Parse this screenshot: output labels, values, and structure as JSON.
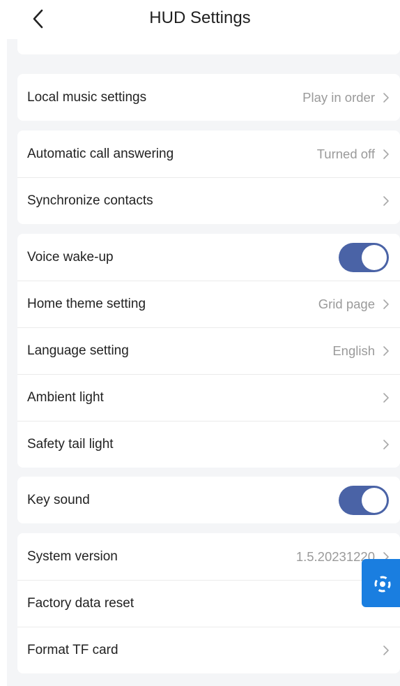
{
  "header": {
    "title": "HUD Settings",
    "back_icon": "chevron-left-icon"
  },
  "groups": {
    "music": {
      "rows": [
        {
          "label": "Local music settings",
          "value": "Play in order"
        }
      ]
    },
    "call": {
      "rows": [
        {
          "label": "Automatic call answering",
          "value": "Turned off"
        },
        {
          "label": "Synchronize contacts",
          "value": ""
        }
      ]
    },
    "general": {
      "rows": [
        {
          "label": "Voice wake-up",
          "toggle": true
        },
        {
          "label": "Home theme setting",
          "value": "Grid page"
        },
        {
          "label": "Language setting",
          "value": "English"
        },
        {
          "label": "Ambient light",
          "value": ""
        },
        {
          "label": "Safety tail light",
          "value": ""
        }
      ]
    },
    "sound": {
      "rows": [
        {
          "label": "Key sound",
          "toggle": true
        }
      ]
    },
    "system": {
      "rows": [
        {
          "label": "System version",
          "value": "1.5.20231220"
        },
        {
          "label": "Factory data reset",
          "value": ""
        },
        {
          "label": "Format TF card",
          "value": ""
        }
      ]
    }
  },
  "colors": {
    "toggle_on": "#4a63a6",
    "floating_button": "#1a7ee0",
    "background": "#f4f5f7"
  },
  "floating_button": {
    "icon": "lifebuoy-support-icon"
  }
}
